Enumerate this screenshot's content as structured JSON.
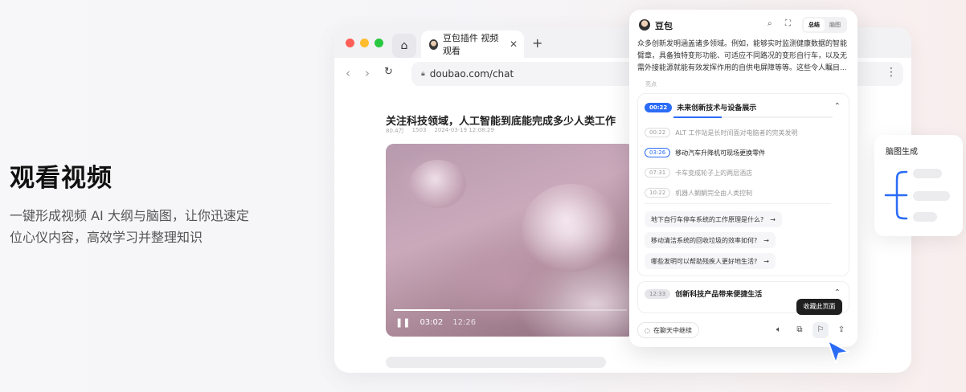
{
  "hero": {
    "title": "观看视频",
    "desc_line1": "一键形成视频 AI 大纲与脑图，让你迅速定",
    "desc_line2": "位心仪内容，高效学习并整理知识"
  },
  "browser": {
    "tab_title": "豆包插件 视频观看",
    "url": "doubao.com/chat",
    "article_title": "关注科技领域，人工智能到底能完成多少人类工作",
    "meta": [
      "80.4万",
      "1503",
      "2024-03-19 12:08:29"
    ],
    "video": {
      "current_time": "03:02",
      "duration": "12:26",
      "progress": 0.24
    },
    "colors": {
      "dot_red": "#ff5f57",
      "dot_yellow": "#febc2e",
      "dot_green": "#28c840"
    }
  },
  "panel": {
    "title": "豆包",
    "seg_summary": "总结",
    "seg_mindmap": "脑图",
    "summary_line1": "众多创新发明涵盖诸多领域。例如，能够实时监测健康数据的智能",
    "summary_line2": "臂章，具备独特变形功能、可适应不同路况的变形自行车，以及无",
    "summary_line3": "需外接能源就能有效发挥作用的自供电屏障等等。这些令人瞩目...",
    "highlights_label": "亮点",
    "chapter1": {
      "time": "00:22",
      "title": "未来创新技术与设备展示",
      "items": [
        {
          "time": "00:22",
          "text": "ALT 工作站是长时间面对电脑者的完美发明"
        },
        {
          "time": "03:26",
          "text": "移动汽车升降机可现场更换零件"
        },
        {
          "time": "07:31",
          "text": "卡车变成轮子上的两层酒店"
        },
        {
          "time": "10:22",
          "text": "机器人鲷鲷完全由人类控制"
        }
      ],
      "questions": [
        "地下自行车停车系统的工作原理是什么?",
        "移动清洁系统的回收垃圾的效率如何?",
        "哪些发明可以帮助残疾人更好地生活?"
      ]
    },
    "chapter2": {
      "time": "12:33",
      "title": "创新科技产品带来便捷生活"
    },
    "continue_chat": "在聊天中继续",
    "tooltip": "收藏此页面",
    "accent": "#2b6cf6"
  },
  "mindmap_card": {
    "title": "脑图生成"
  }
}
